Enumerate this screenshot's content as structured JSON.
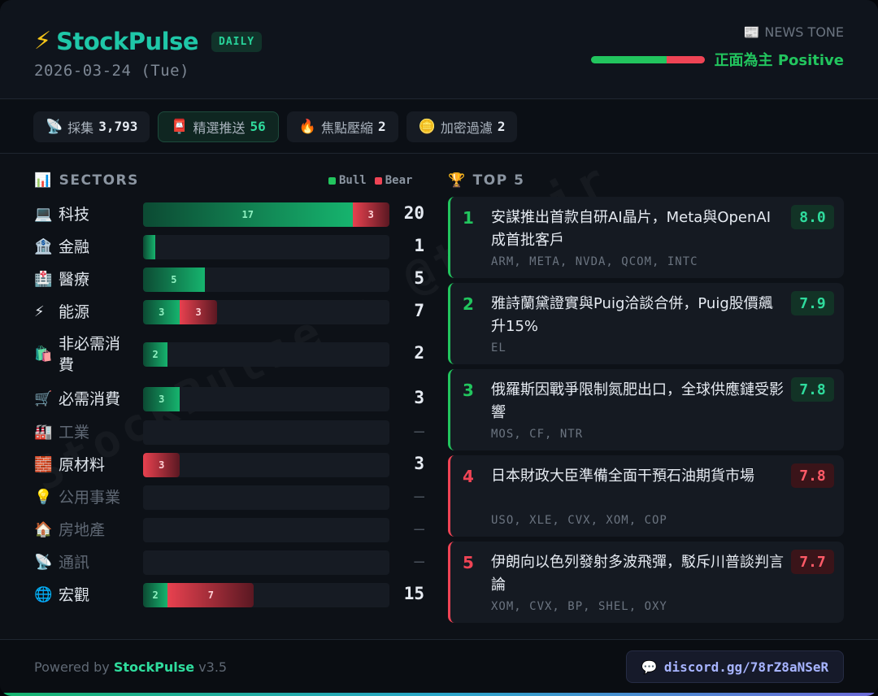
{
  "header": {
    "brand_icon": "bolt-icon",
    "brand_name": "StockPulse",
    "badge": "DAILY",
    "date": "2026-03-24 (Tue)",
    "tone_label": "NEWS TONE",
    "tone_text": "正面為主 Positive",
    "tone_positive_fraction": 0.67
  },
  "stats": [
    {
      "icon": "📡",
      "label": "採集",
      "value": "3,793"
    },
    {
      "icon": "📮",
      "label": "精選推送",
      "value": "56"
    },
    {
      "icon": "🔥",
      "label": "焦點壓縮",
      "value": "2"
    },
    {
      "icon": "🪙",
      "label": "加密過濾",
      "value": "2"
    }
  ],
  "sectors_panel": {
    "title": "SECTORS",
    "legend_bull": "Bull",
    "legend_bear": "Bear",
    "max_scale": 20
  },
  "chart_data": {
    "type": "bar",
    "categories": [
      "科技",
      "金融",
      "醫療",
      "能源",
      "非必需消費",
      "必需消費",
      "工業",
      "原材料",
      "公用事業",
      "房地產",
      "通訊",
      "宏觀"
    ],
    "series": [
      {
        "name": "Bull",
        "values": [
          17,
          1,
          5,
          3,
          2,
          3,
          0,
          0,
          0,
          0,
          0,
          2
        ]
      },
      {
        "name": "Bear",
        "values": [
          3,
          0,
          0,
          3,
          0,
          0,
          0,
          3,
          0,
          0,
          0,
          7
        ]
      }
    ],
    "totals": [
      "20",
      "1",
      "5",
      "7",
      "2",
      "3",
      "–",
      "3",
      "–",
      "–",
      "–",
      "15"
    ],
    "icons": [
      "💻",
      "🏦",
      "🏥",
      "⚡",
      "🛍️",
      "🛒",
      "🏭",
      "🧱",
      "💡",
      "🏠",
      "📡",
      "🌐"
    ]
  },
  "top5": {
    "title": "TOP 5",
    "items": [
      {
        "rank": "1",
        "headline": "安謀推出首款自研AI晶片，Meta與OpenAI成首批客戶",
        "tickers": "ARM, META, NVDA, QCOM, INTC",
        "score": "8.0",
        "tone": "positive"
      },
      {
        "rank": "2",
        "headline": "雅詩蘭黛證實與Puig洽談合併，Puig股價飆升15%",
        "tickers": "EL",
        "score": "7.9",
        "tone": "positive"
      },
      {
        "rank": "3",
        "headline": "俄羅斯因戰爭限制氮肥出口，全球供應鏈受影響",
        "tickers": "MOS, CF, NTR",
        "score": "7.8",
        "tone": "positive"
      },
      {
        "rank": "4",
        "headline": "日本財政大臣準備全面干預石油期貨市場",
        "tickers": "USO, XLE, CVX, XOM, COP",
        "score": "7.8",
        "tone": "negative"
      },
      {
        "rank": "5",
        "headline": "伊朗向以色列發射多波飛彈，駁斥川普談判言論",
        "tickers": "XOM, CVX, BP, SHEL, OXY",
        "score": "7.7",
        "tone": "negative"
      }
    ]
  },
  "footer": {
    "powered_prefix": "Powered by",
    "powered_brand": "StockPulse",
    "version": "v3.5",
    "discord": "discord.gg/78rZ8aNSeR"
  },
  "watermark": "StockPulse · @theAir",
  "colors": {
    "bull": "#22c55e",
    "bear": "#ef4455",
    "brand": "#1fc7a8"
  }
}
